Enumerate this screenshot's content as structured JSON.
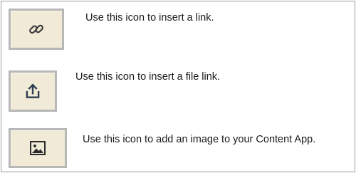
{
  "rows": [
    {
      "icon": "link-icon",
      "text": "Use this icon to insert a link."
    },
    {
      "icon": "upload-icon",
      "text": "Use this icon to insert a file link."
    },
    {
      "icon": "image-icon",
      "text": "Use this icon to add an image to your Content App."
    }
  ]
}
